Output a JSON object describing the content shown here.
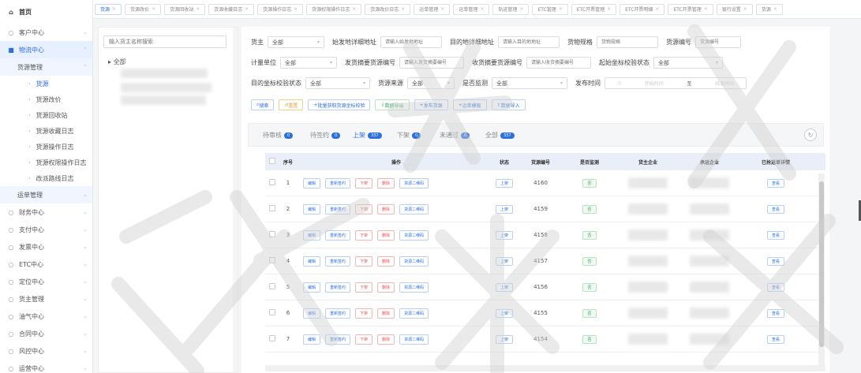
{
  "sidebar": {
    "home": "首页",
    "items": [
      {
        "label": "客户中心",
        "icon": "user-icon"
      },
      {
        "label": "物流中心",
        "icon": "truck-icon",
        "active": true
      },
      {
        "label": "货源管理",
        "sub": true
      },
      {
        "label": "货源",
        "leaf": true,
        "current": true
      },
      {
        "label": "货源改价",
        "leaf": true
      },
      {
        "label": "货源回收站",
        "leaf": true
      },
      {
        "label": "货源收藏日志",
        "leaf": true
      },
      {
        "label": "货源操作日志",
        "leaf": true
      },
      {
        "label": "货源权限操作日志",
        "leaf": true
      },
      {
        "label": "改派路线日志",
        "leaf": true
      },
      {
        "label": "运单管理",
        "sub": true
      },
      {
        "label": "财务中心",
        "icon": "finance-icon"
      },
      {
        "label": "支付中心",
        "icon": "pay-icon"
      },
      {
        "label": "发票中心",
        "icon": "invoice-icon"
      },
      {
        "label": "ETC中心",
        "icon": "etc-icon"
      },
      {
        "label": "定位中心",
        "icon": "location-icon"
      },
      {
        "label": "货主管理",
        "icon": "owner-icon"
      },
      {
        "label": "油气中心",
        "icon": "fuel-icon"
      },
      {
        "label": "合同中心",
        "icon": "contract-icon"
      },
      {
        "label": "风控中心",
        "icon": "risk-icon"
      },
      {
        "label": "运营中心",
        "icon": "ops-icon"
      }
    ]
  },
  "tabs": [
    {
      "label": "货源",
      "active": true
    },
    {
      "label": "货源改价"
    },
    {
      "label": "货源回收站"
    },
    {
      "label": "货源收藏日志"
    },
    {
      "label": "货源操作日志"
    },
    {
      "label": "货源权限操作日志"
    },
    {
      "label": "货源改价日志"
    },
    {
      "label": "运单管理"
    },
    {
      "label": "运单管理"
    },
    {
      "label": "轨迹管理"
    },
    {
      "label": "ETC管理"
    },
    {
      "label": "ETC开票管理"
    },
    {
      "label": "ETC开票明细"
    },
    {
      "label": "ETC开票管理"
    },
    {
      "label": "银行设置"
    },
    {
      "label": "货源"
    }
  ],
  "tree": {
    "search_placeholder": "输入货主名称搜索",
    "root": "全部"
  },
  "filters": {
    "owner_label": "货主",
    "owner_value": "全部",
    "origin_label": "始发地详细地址",
    "origin_placeholder": "请输入始发地地址",
    "dest_label": "目的地详细地址",
    "dest_placeholder": "请输入目的地地址",
    "spec_label": "货物规格",
    "spec_placeholder": "货物规格",
    "cargo_no_label": "货源编号",
    "cargo_no_placeholder": "货源编号",
    "unit_label": "计量单位",
    "unit_value": "全部",
    "send_label": "发货摘要货源编号",
    "send_placeholder": "请输入发货摘要编号",
    "recv_label": "收货摘要货源编号",
    "recv_placeholder": "请输入收货摘要编号",
    "startcheck_label": "起始坐标校验状态",
    "startcheck_value": "全部",
    "destcheck_label": "目的坐标校验状态",
    "destcheck_value": "全部",
    "source_label": "货源来源",
    "source_value": "全部",
    "monitor_label": "是否监测",
    "monitor_value": "全部",
    "pubtime_label": "发布时间",
    "start_placeholder": "开始时间",
    "to": "至",
    "end_placeholder": "结束时间"
  },
  "actions": [
    "搜索",
    "重置",
    "批量获取货源坐标校验",
    "数据导出",
    "发布货源",
    "运单模板",
    "数据导入"
  ],
  "status_tabs": [
    {
      "label": "待审核",
      "count": "0"
    },
    {
      "label": "待签约",
      "count": "0"
    },
    {
      "label": "上架",
      "count": "337",
      "active": true
    },
    {
      "label": "下架",
      "count": "0"
    },
    {
      "label": "未通过",
      "count": "0"
    },
    {
      "label": "全部",
      "count": "337"
    }
  ],
  "table": {
    "headers": [
      "序号",
      "操作",
      "状态",
      "货源编号",
      "是否监测",
      "货主企业",
      "承运企业",
      "已抢运单详情"
    ],
    "op_labels": [
      "编辑",
      "重新签约",
      "下架",
      "删除",
      "货源二维码"
    ],
    "detail_label": "查看",
    "rows": [
      {
        "seq": "1",
        "status": "上架",
        "no": "4160",
        "monitor": "否"
      },
      {
        "seq": "2",
        "status": "上架",
        "no": "4159",
        "monitor": "否"
      },
      {
        "seq": "3",
        "status": "上架",
        "no": "4158",
        "monitor": "否"
      },
      {
        "seq": "4",
        "status": "上架",
        "no": "4157",
        "monitor": "否"
      },
      {
        "seq": "5",
        "status": "上架",
        "no": "4156",
        "monitor": "否"
      },
      {
        "seq": "6",
        "status": "上架",
        "no": "4155",
        "monitor": "否"
      },
      {
        "seq": "7",
        "status": "上架",
        "no": "4154",
        "monitor": "否"
      }
    ]
  },
  "colors": {
    "accent": "#2b6fe0",
    "danger": "#e55353",
    "success": "#3aa55a",
    "warning": "#e6a23c"
  }
}
